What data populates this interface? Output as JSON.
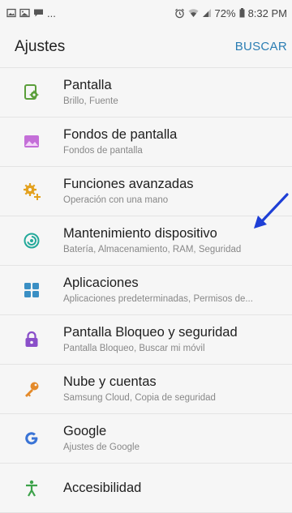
{
  "status": {
    "left_ellipsis": "...",
    "battery": "72%",
    "time": "8:32 PM"
  },
  "header": {
    "title": "Ajustes",
    "action": "BUSCAR"
  },
  "items": [
    {
      "label": "Pantalla",
      "sub": "Brillo, Fuente",
      "icon": "display-gear-icon",
      "color": "#5a9e3a"
    },
    {
      "label": "Fondos de pantalla",
      "sub": "Fondos de pantalla",
      "icon": "wallpaper-icon",
      "color": "#b455c9"
    },
    {
      "label": "Funciones avanzadas",
      "sub": "Operación con una mano",
      "icon": "advanced-gear-plus-icon",
      "color": "#e3a11e"
    },
    {
      "label": "Mantenimiento dispositivo",
      "sub": "Batería, Almacenamiento, RAM, Seguridad",
      "icon": "device-care-icon",
      "color": "#23a99a"
    },
    {
      "label": "Aplicaciones",
      "sub": "Aplicaciones predeterminadas, Permisos de...",
      "icon": "apps-grid-icon",
      "color": "#3a8fc4"
    },
    {
      "label": "Pantalla Bloqueo y seguridad",
      "sub": "Pantalla Bloqueo, Buscar mi móvil",
      "icon": "lock-icon",
      "color": "#8a4fc9"
    },
    {
      "label": "Nube y cuentas",
      "sub": "Samsung Cloud, Copia de seguridad",
      "icon": "key-icon",
      "color": "#e48a2a"
    },
    {
      "label": "Google",
      "sub": "Ajustes de Google",
      "icon": "google-g-icon",
      "color": "#3a74d6"
    },
    {
      "label": "Accesibilidad",
      "sub": "",
      "icon": "accessibility-icon",
      "color": "#3ca24a"
    }
  ]
}
